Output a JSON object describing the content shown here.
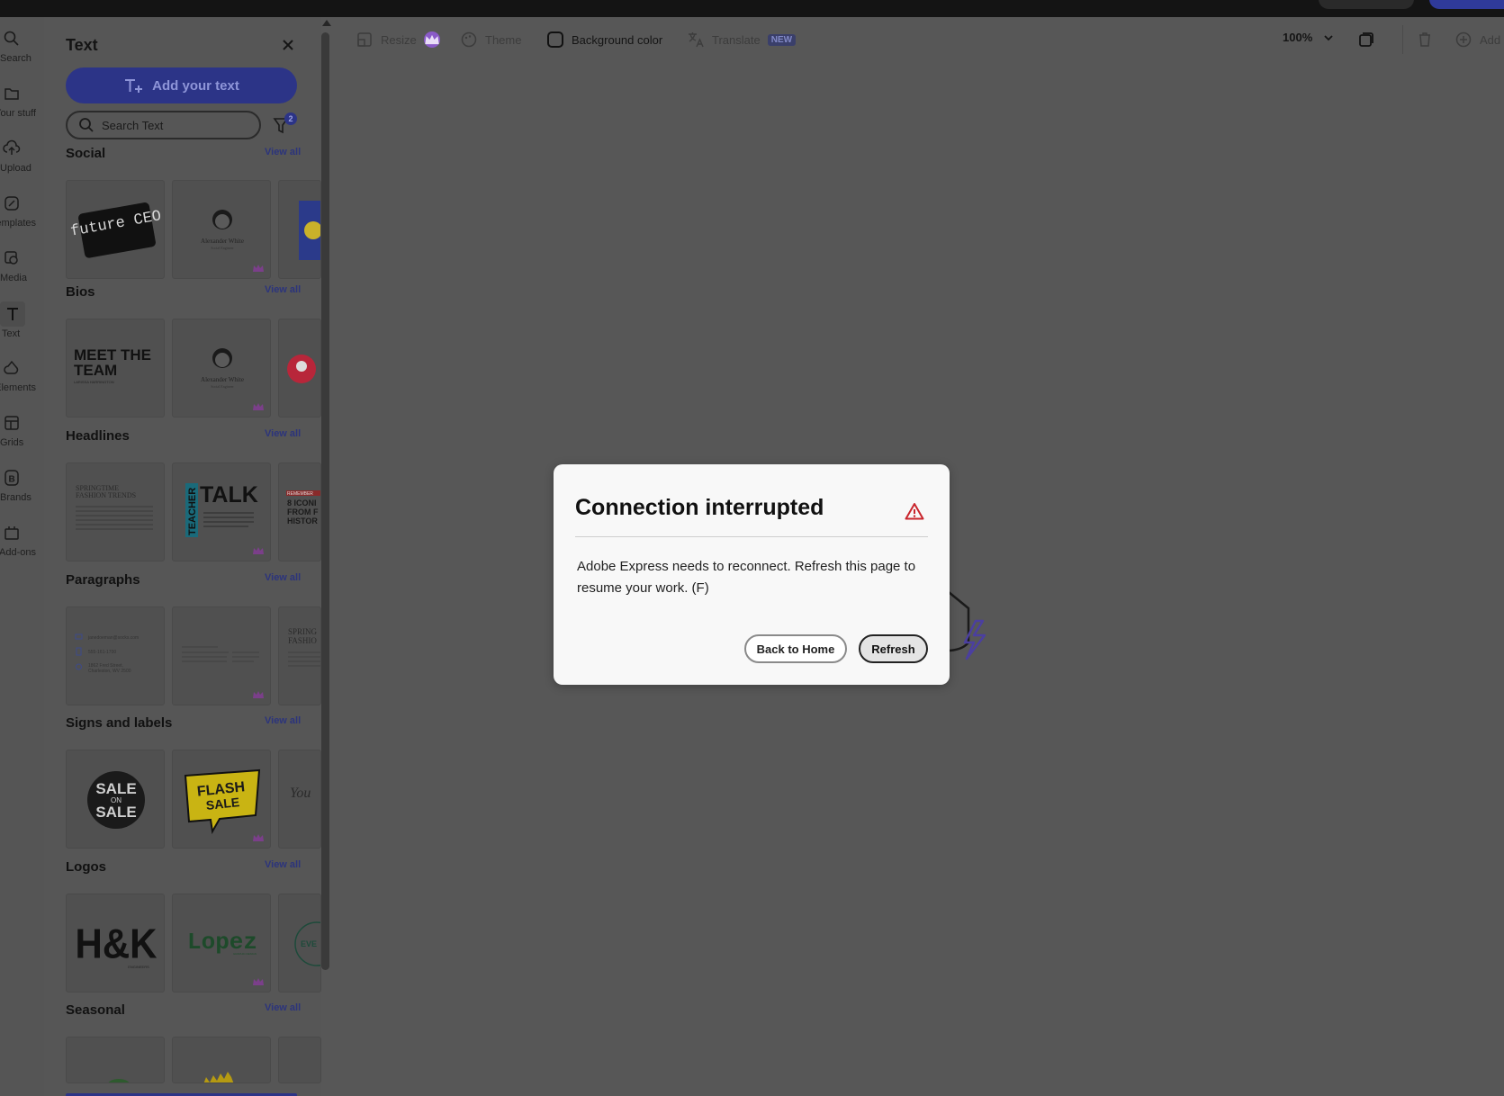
{
  "rail": {
    "items": [
      {
        "label": "Search",
        "icon": "search-icon"
      },
      {
        "label": "Your stuff",
        "icon": "folder-icon"
      },
      {
        "label": "Upload",
        "icon": "upload-icon"
      },
      {
        "label": "Templates",
        "icon": "templates-icon"
      },
      {
        "label": "Media",
        "icon": "media-icon"
      },
      {
        "label": "Text",
        "icon": "text-icon",
        "active": true
      },
      {
        "label": "Elements",
        "icon": "elements-icon"
      },
      {
        "label": "Grids",
        "icon": "grids-icon"
      },
      {
        "label": "Brands",
        "icon": "brands-icon"
      },
      {
        "label": "Add-ons",
        "icon": "addons-icon"
      }
    ]
  },
  "panel": {
    "title": "Text",
    "add_text_label": "Add your text",
    "search_placeholder": "Search Text",
    "filter_count": "2",
    "view_all_label": "View all",
    "sections": [
      {
        "title": "Social"
      },
      {
        "title": "Bios"
      },
      {
        "title": "Headlines"
      },
      {
        "title": "Paragraphs"
      },
      {
        "title": "Signs and labels"
      },
      {
        "title": "Logos"
      },
      {
        "title": "Seasonal"
      }
    ],
    "thumb_text": {
      "future_ceo": "future CEO",
      "alexander": "Alexander White",
      "alexander_sub": "Social Engineer",
      "meet_team": "MEET THE TEAM",
      "meet_team_sub": "LARISSA HARRINGTON",
      "springtime": "SPRINGTIME FASHION TRENDS",
      "teacher": "TEACHER",
      "talk": "TALK",
      "remember": "REMEMBER",
      "icons": "8 ICONI FROM HISTOR",
      "email": "janedoeman@socks.com",
      "phone": "555-161-1700",
      "address": "1862 Fred Street, Charleston, WV 2500",
      "spring_fashio": "SPRING FASHIO",
      "sale_on_sale_1": "SALE",
      "sale_on_sale_2": "ON",
      "sale_on_sale_3": "SALE",
      "flash": "FLASH",
      "flash_sale": "SALE",
      "you": "You",
      "hk": "H&K",
      "hk_sub": "ENGINEERS",
      "lopez": "Lopez",
      "lopez_sub": "GRAPHIC DESIGN",
      "eve": "EVE"
    }
  },
  "toolbar": {
    "resize_label": "Resize",
    "theme_label": "Theme",
    "background_label": "Background color",
    "translate_label": "Translate",
    "translate_badge": "NEW",
    "zoom_value": "100%",
    "add_label": "Add"
  },
  "modal": {
    "title": "Connection interrupted",
    "body": "Adobe Express needs to reconnect. Refresh this page to resume your work. (F)",
    "back_home_label": "Back to Home",
    "refresh_label": "Refresh"
  },
  "colors": {
    "accent": "#2c3487",
    "overlay_bg": "#575757",
    "modal_bg": "#f8f8f8",
    "warning": "#c9252c",
    "premium": "#8a5ac8"
  }
}
